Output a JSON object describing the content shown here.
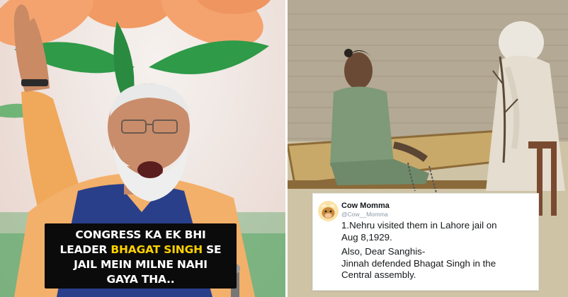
{
  "caption": {
    "line1": "CONGRESS KA EK BHI",
    "line2_before": "LEADER ",
    "line2_highlight": "BHAGAT SINGH",
    "line2_after": " SE",
    "line3": "JAIL MEIN MILNE NAHI",
    "line4": "GAYA THA..",
    "highlight_color": "#ffd200"
  },
  "tweet": {
    "display_name": "Cow Momma",
    "handle": "@Cow__Momma",
    "paragraph1_line1": "1.Nehru visited them in Lahore jail on",
    "paragraph1_line2": "Aug 8,1929.",
    "paragraph2_line1": "Also, Dear Sanghis-",
    "paragraph2_line2": "Jinnah defended Bhagat Singh in the",
    "paragraph2_line3": "Central assembly."
  },
  "icons": {
    "avatar": "cow-avatar-icon"
  },
  "colors": {
    "caption_bg": "#0b0b0b",
    "caption_text": "#ffffff",
    "vest": "#2a3f8a",
    "kurta": "#f0a85a"
  }
}
